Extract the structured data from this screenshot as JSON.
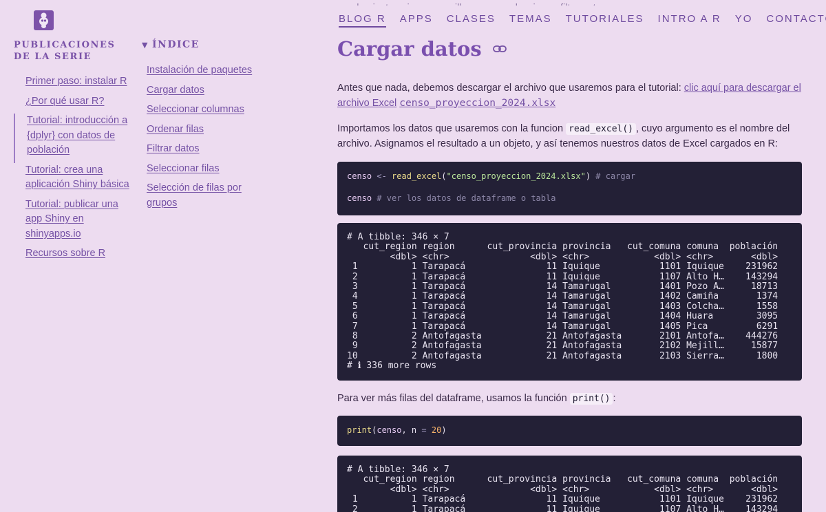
{
  "header": {
    "nav": [
      "BLOG R",
      "APPS",
      "CLASES",
      "TEMAS",
      "TUTORIALES",
      "INTRO A R",
      "YO",
      "CONTACTO"
    ],
    "active_index": 0
  },
  "sidebar": {
    "series_title": "Publicaciones de la serie",
    "items": [
      "Primer paso: instalar R",
      "¿Por qué usar R?",
      "Tutorial: introducción a {dplyr} con datos de población",
      "Tutorial: crea una aplicación Shiny básica",
      "Tutorial: publicar una app Shiny en shinyapps.io",
      "Recursos sobre R"
    ],
    "active_index": 2
  },
  "toc": {
    "title": "Índice",
    "items": [
      "Instalación de paquetes",
      "Cargar datos",
      "Seleccionar columnas",
      "Ordenar filas",
      "Filtrar datos",
      "Seleccionar filas",
      "Selección de filas por grupos"
    ]
  },
  "main": {
    "cutoff_text": "emulan instrucciones sencillas, como seleccionar, filtrar, etc.",
    "heading": "Cargar datos",
    "p1_text": "Antes que nada, debemos descargar el archivo que usaremos para el tutorial: ",
    "p1_link": "clic aquí para descargar el archivo Excel",
    "p1_file": "censo_proyeccion_2024.xlsx",
    "p2_a": "Importamos los datos que usaremos con la funcion ",
    "p2_code": "read_excel()",
    "p2_b": ", cuyo argumento es el nombre del archivo. Asignamos el resultado a un objeto, y así tenemos nuestros datos de Excel cargados en R:",
    "code1": {
      "var": "censo",
      "op": "<-",
      "fn": "read_excel",
      "str": "\"censo_proyeccion_2024.xlsx\"",
      "comment1": "# cargar",
      "line2_var": "censo",
      "comment2": "# ver los datos de dataframe o tabla"
    },
    "output1": [
      "# A tibble: 346 × 7",
      "   cut_region region      cut_provincia provincia   cut_comuna comuna  población",
      "        <dbl> <chr>               <dbl> <chr>            <dbl> <chr>       <dbl>",
      " 1          1 Tarapacá               11 Iquique           1101 Iquique    231962",
      " 2          1 Tarapacá               11 Iquique           1107 Alto H…    143294",
      " 3          1 Tarapacá               14 Tamarugal         1401 Pozo A…     18713",
      " 4          1 Tarapacá               14 Tamarugal         1402 Camiña       1374",
      " 5          1 Tarapacá               14 Tamarugal         1403 Colcha…      1558",
      " 6          1 Tarapacá               14 Tamarugal         1404 Huara        3095",
      " 7          1 Tarapacá               14 Tamarugal         1405 Pica         6291",
      " 8          2 Antofagasta            21 Antofagasta       2101 Antofa…    444276",
      " 9          2 Antofagasta            21 Antofagasta       2102 Mejill…     15877",
      "10          2 Antofagasta            21 Antofagasta       2103 Sierra…      1800",
      "# ℹ 336 more rows"
    ],
    "p3_a": "Para ver más filas del dataframe, usamos la función ",
    "p3_code": "print()",
    "p3_b": ":",
    "code2": {
      "fn": "print",
      "open": "(",
      "var": "censo",
      "sep": ", n ",
      "op": "=",
      "num": "20",
      "close": ")"
    },
    "output2": [
      "# A tibble: 346 × 7",
      "   cut_region region      cut_provincia provincia   cut_comuna comuna  población",
      "        <dbl> <chr>               <dbl> <chr>            <dbl> <chr>       <dbl>",
      " 1          1 Tarapacá               11 Iquique           1101 Iquique    231962",
      " 2          1 Tarapacá               11 Iquique           1107 Alto H…    143294"
    ]
  }
}
